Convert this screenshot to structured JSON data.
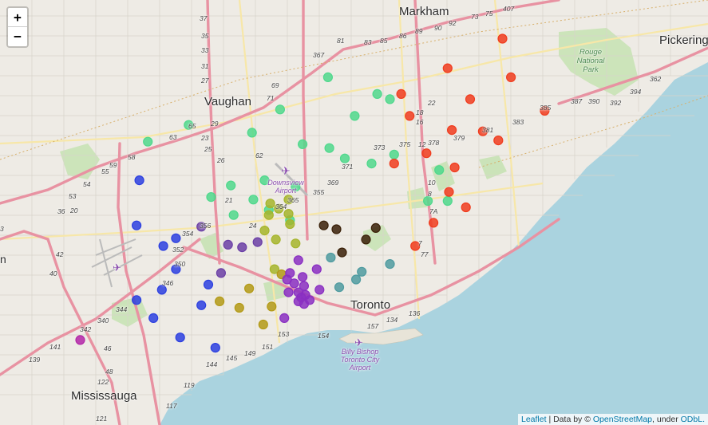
{
  "map": {
    "zoom_in_label": "+",
    "zoom_out_label": "−",
    "attribution": {
      "leaflet": "Leaflet",
      "text1": "| Data by ©",
      "osm": "OpenStreetMap",
      "text2": ", under",
      "odbl": "ODbL."
    },
    "places": {
      "markham": "Markham",
      "vaughan": "Vaughan",
      "pickering": "Pickering",
      "mississauga": "Mississauga",
      "toronto": "Toronto",
      "west_edge": "n",
      "rouge_park": "Rouge National Park",
      "downsview": "Downsview Airport",
      "billy_bishop": "Billy Bishop Toronto City Airport"
    },
    "highway_labels": [
      "407",
      "37",
      "35",
      "33",
      "31",
      "27",
      "25",
      "23",
      "21",
      "29",
      "26",
      "65",
      "63",
      "58",
      "59",
      "55",
      "54",
      "53",
      "20",
      "24",
      "22",
      "18",
      "16",
      "12",
      "10",
      "8",
      "7A",
      "7",
      "77",
      "81",
      "83",
      "85",
      "86",
      "89",
      "90",
      "92",
      "73",
      "75",
      "69",
      "71",
      "367",
      "369",
      "371",
      "373",
      "375",
      "378",
      "379",
      "381",
      "383",
      "385",
      "387",
      "390",
      "392",
      "394",
      "362",
      "364",
      "365",
      "355",
      "356",
      "354",
      "352",
      "350",
      "346",
      "344",
      "340",
      "342",
      "139",
      "141",
      "144",
      "145",
      "149",
      "151",
      "153",
      "154",
      "157",
      "134",
      "136",
      "117",
      "119",
      "121",
      "122",
      "48",
      "46",
      "42",
      "40",
      "36",
      "3",
      "62"
    ],
    "cluster_colors": {
      "green": "#4fd88c",
      "blue": "#2c3fe0",
      "purple": "#8a2fc2",
      "violet": "#6b3fa6",
      "olive": "#a6b52c",
      "gold": "#b39a16",
      "black": "#3a2008",
      "teal": "#4f9ba0",
      "red": "#f03c1e",
      "magenta": "#b326a8"
    },
    "markers": [
      {
        "cluster": "green",
        "lat": 43.855,
        "lng": -79.42
      },
      {
        "cluster": "green",
        "lat": 43.842,
        "lng": -79.385
      },
      {
        "cluster": "green",
        "lat": 43.838,
        "lng": -79.376
      },
      {
        "cluster": "green",
        "lat": 43.83,
        "lng": -79.454
      },
      {
        "cluster": "green",
        "lat": 43.825,
        "lng": -79.401
      },
      {
        "cluster": "green",
        "lat": 43.818,
        "lng": -79.519
      },
      {
        "cluster": "green",
        "lat": 43.812,
        "lng": -79.474
      },
      {
        "cluster": "green",
        "lat": 43.805,
        "lng": -79.548
      },
      {
        "cluster": "green",
        "lat": 43.803,
        "lng": -79.438
      },
      {
        "cluster": "green",
        "lat": 43.8,
        "lng": -79.419
      },
      {
        "cluster": "green",
        "lat": 43.795,
        "lng": -79.373
      },
      {
        "cluster": "green",
        "lat": 43.792,
        "lng": -79.408
      },
      {
        "cluster": "green",
        "lat": 43.788,
        "lng": -79.389
      },
      {
        "cluster": "green",
        "lat": 43.783,
        "lng": -79.341
      },
      {
        "cluster": "green",
        "lat": 43.775,
        "lng": -79.465
      },
      {
        "cluster": "green",
        "lat": 43.771,
        "lng": -79.489
      },
      {
        "cluster": "green",
        "lat": 43.77,
        "lng": -79.443
      },
      {
        "cluster": "green",
        "lat": 43.762,
        "lng": -79.503
      },
      {
        "cluster": "green",
        "lat": 43.76,
        "lng": -79.473
      },
      {
        "cluster": "green",
        "lat": 43.759,
        "lng": -79.349
      },
      {
        "cluster": "green",
        "lat": 43.759,
        "lng": -79.335
      },
      {
        "cluster": "green",
        "lat": 43.752,
        "lng": -79.462
      },
      {
        "cluster": "green",
        "lat": 43.748,
        "lng": -79.487
      },
      {
        "cluster": "green",
        "lat": 43.744,
        "lng": -79.447
      },
      {
        "cluster": "blue",
        "lat": 43.775,
        "lng": -79.554
      },
      {
        "cluster": "blue",
        "lat": 43.74,
        "lng": -79.556
      },
      {
        "cluster": "blue",
        "lat": 43.73,
        "lng": -79.528
      },
      {
        "cluster": "blue",
        "lat": 43.724,
        "lng": -79.537
      },
      {
        "cluster": "blue",
        "lat": 43.706,
        "lng": -79.528
      },
      {
        "cluster": "blue",
        "lat": 43.694,
        "lng": -79.505
      },
      {
        "cluster": "blue",
        "lat": 43.69,
        "lng": -79.538
      },
      {
        "cluster": "blue",
        "lat": 43.682,
        "lng": -79.556
      },
      {
        "cluster": "blue",
        "lat": 43.678,
        "lng": -79.51
      },
      {
        "cluster": "blue",
        "lat": 43.668,
        "lng": -79.544
      },
      {
        "cluster": "blue",
        "lat": 43.653,
        "lng": -79.525
      },
      {
        "cluster": "blue",
        "lat": 43.645,
        "lng": -79.5
      },
      {
        "cluster": "violet",
        "lat": 43.739,
        "lng": -79.51
      },
      {
        "cluster": "violet",
        "lat": 43.725,
        "lng": -79.491
      },
      {
        "cluster": "violet",
        "lat": 43.723,
        "lng": -79.481
      },
      {
        "cluster": "violet",
        "lat": 43.727,
        "lng": -79.47
      },
      {
        "cluster": "violet",
        "lat": 43.703,
        "lng": -79.496
      },
      {
        "cluster": "olive",
        "lat": 43.76,
        "lng": -79.448
      },
      {
        "cluster": "olive",
        "lat": 43.757,
        "lng": -79.461
      },
      {
        "cluster": "olive",
        "lat": 43.753,
        "lng": -79.455
      },
      {
        "cluster": "olive",
        "lat": 43.749,
        "lng": -79.448
      },
      {
        "cluster": "olive",
        "lat": 43.748,
        "lng": -79.462
      },
      {
        "cluster": "olive",
        "lat": 43.741,
        "lng": -79.447
      },
      {
        "cluster": "olive",
        "lat": 43.736,
        "lng": -79.465
      },
      {
        "cluster": "olive",
        "lat": 43.729,
        "lng": -79.457
      },
      {
        "cluster": "olive",
        "lat": 43.726,
        "lng": -79.443
      },
      {
        "cluster": "olive",
        "lat": 43.706,
        "lng": -79.458
      },
      {
        "cluster": "gold",
        "lat": 43.702,
        "lng": -79.453
      },
      {
        "cluster": "gold",
        "lat": 43.691,
        "lng": -79.476
      },
      {
        "cluster": "gold",
        "lat": 43.681,
        "lng": -79.497
      },
      {
        "cluster": "gold",
        "lat": 43.676,
        "lng": -79.483
      },
      {
        "cluster": "gold",
        "lat": 43.677,
        "lng": -79.46
      },
      {
        "cluster": "gold",
        "lat": 43.663,
        "lng": -79.466
      },
      {
        "cluster": "black",
        "lat": 43.74,
        "lng": -79.423
      },
      {
        "cluster": "black",
        "lat": 43.737,
        "lng": -79.414
      },
      {
        "cluster": "black",
        "lat": 43.738,
        "lng": -79.386
      },
      {
        "cluster": "black",
        "lat": 43.729,
        "lng": -79.393
      },
      {
        "cluster": "black",
        "lat": 43.719,
        "lng": -79.41
      },
      {
        "cluster": "teal",
        "lat": 43.715,
        "lng": -79.418
      },
      {
        "cluster": "teal",
        "lat": 43.71,
        "lng": -79.376
      },
      {
        "cluster": "teal",
        "lat": 43.704,
        "lng": -79.396
      },
      {
        "cluster": "teal",
        "lat": 43.698,
        "lng": -79.4
      },
      {
        "cluster": "teal",
        "lat": 43.692,
        "lng": -79.412
      },
      {
        "cluster": "purple",
        "lat": 43.713,
        "lng": -79.441
      },
      {
        "cluster": "purple",
        "lat": 43.706,
        "lng": -79.428
      },
      {
        "cluster": "purple",
        "lat": 43.703,
        "lng": -79.447
      },
      {
        "cluster": "purple",
        "lat": 43.7,
        "lng": -79.438
      },
      {
        "cluster": "purple",
        "lat": 43.698,
        "lng": -79.449
      },
      {
        "cluster": "purple",
        "lat": 43.695,
        "lng": -79.444
      },
      {
        "cluster": "purple",
        "lat": 43.693,
        "lng": -79.437
      },
      {
        "cluster": "purple",
        "lat": 43.69,
        "lng": -79.426
      },
      {
        "cluster": "purple",
        "lat": 43.688,
        "lng": -79.448
      },
      {
        "cluster": "purple",
        "lat": 43.688,
        "lng": -79.441
      },
      {
        "cluster": "purple",
        "lat": 43.686,
        "lng": -79.436
      },
      {
        "cluster": "purple",
        "lat": 43.684,
        "lng": -79.439
      },
      {
        "cluster": "purple",
        "lat": 43.682,
        "lng": -79.433
      },
      {
        "cluster": "purple",
        "lat": 43.681,
        "lng": -79.441
      },
      {
        "cluster": "purple",
        "lat": 43.679,
        "lng": -79.437
      },
      {
        "cluster": "purple",
        "lat": 43.668,
        "lng": -79.451
      },
      {
        "cluster": "red",
        "lat": 43.885,
        "lng": -79.296
      },
      {
        "cluster": "red",
        "lat": 43.862,
        "lng": -79.335
      },
      {
        "cluster": "red",
        "lat": 43.855,
        "lng": -79.29
      },
      {
        "cluster": "red",
        "lat": 43.842,
        "lng": -79.368
      },
      {
        "cluster": "red",
        "lat": 43.838,
        "lng": -79.319
      },
      {
        "cluster": "red",
        "lat": 43.825,
        "lng": -79.362
      },
      {
        "cluster": "red",
        "lat": 43.829,
        "lng": -79.266
      },
      {
        "cluster": "red",
        "lat": 43.814,
        "lng": -79.332
      },
      {
        "cluster": "red",
        "lat": 43.813,
        "lng": -79.31
      },
      {
        "cluster": "red",
        "lat": 43.806,
        "lng": -79.299
      },
      {
        "cluster": "red",
        "lat": 43.796,
        "lng": -79.35
      },
      {
        "cluster": "red",
        "lat": 43.788,
        "lng": -79.373
      },
      {
        "cluster": "red",
        "lat": 43.785,
        "lng": -79.33
      },
      {
        "cluster": "red",
        "lat": 43.766,
        "lng": -79.334
      },
      {
        "cluster": "red",
        "lat": 43.754,
        "lng": -79.322
      },
      {
        "cluster": "red",
        "lat": 43.742,
        "lng": -79.345
      },
      {
        "cluster": "red",
        "lat": 43.724,
        "lng": -79.358
      },
      {
        "cluster": "magenta",
        "lat": 43.651,
        "lng": -79.596
      }
    ]
  }
}
